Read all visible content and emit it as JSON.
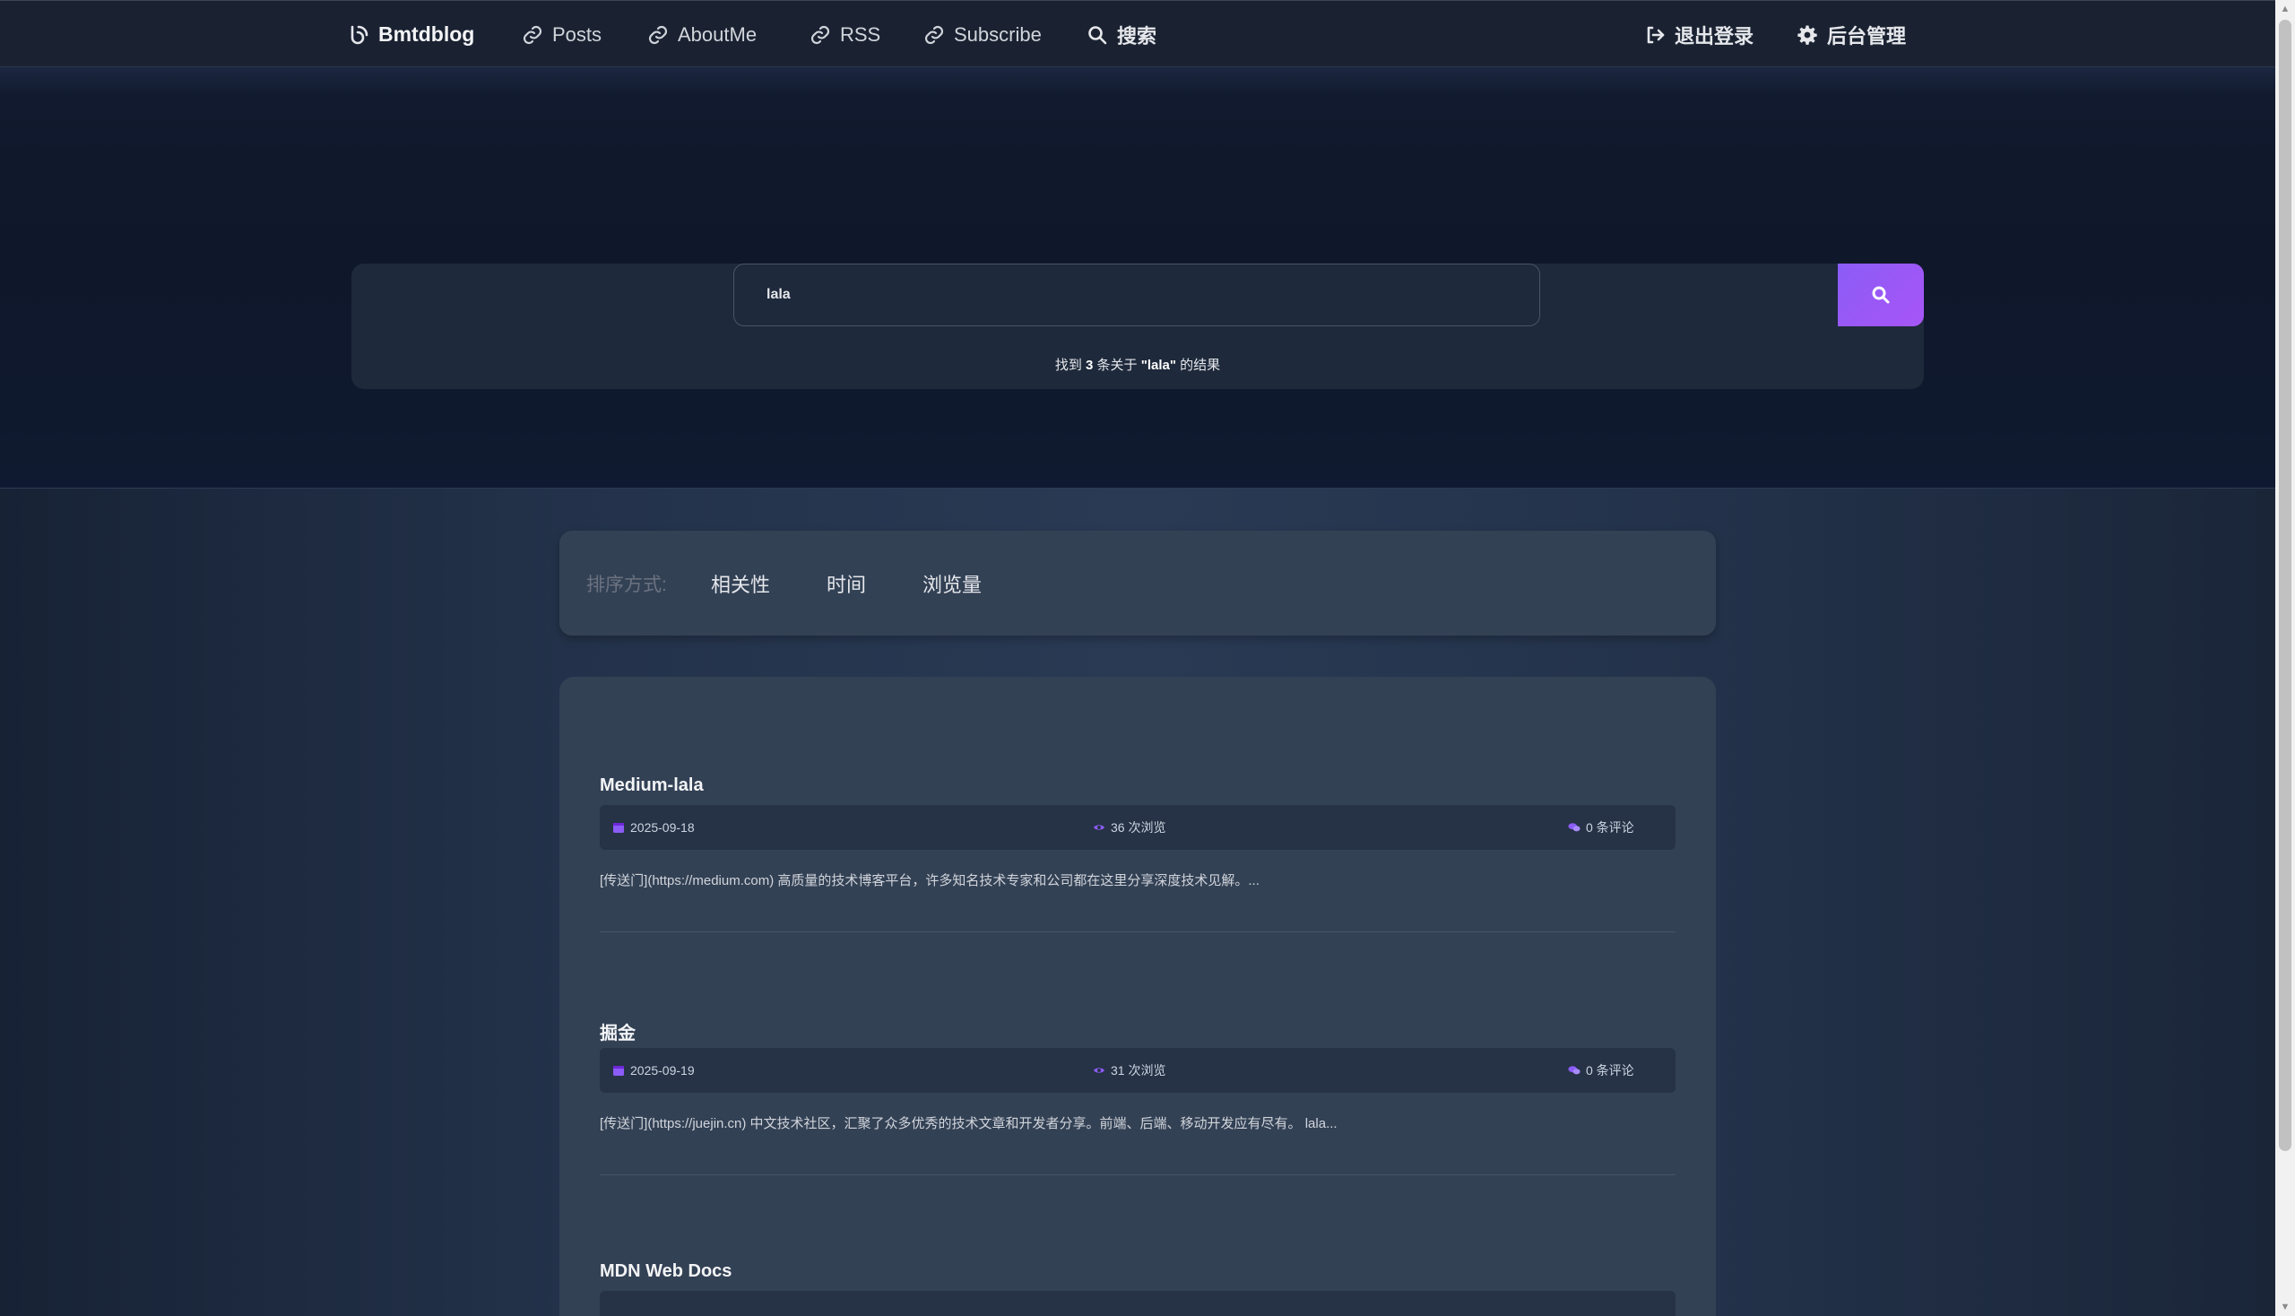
{
  "nav": {
    "brand": "Bmtdblog",
    "links": [
      {
        "label": "Posts",
        "icon": "link-icon"
      },
      {
        "label": "AboutMe",
        "icon": "link-icon"
      },
      {
        "label": "RSS",
        "icon": "link-icon"
      },
      {
        "label": "Subscribe",
        "icon": "link-icon"
      }
    ],
    "search": "搜索",
    "logout": "退出登录",
    "admin": "后台管理"
  },
  "search": {
    "query": "lala",
    "result_prefix": "找到",
    "result_count": "3",
    "result_middle": "条关于",
    "result_term": "\"lala\"",
    "result_suffix": "的结果"
  },
  "sort": {
    "label": "排序方式:",
    "options": [
      "相关性",
      "时间",
      "浏览量"
    ]
  },
  "posts": [
    {
      "title": "Medium-lala",
      "date": "2025-09-18",
      "views": "36 次浏览",
      "comments": "0 条评论",
      "excerpt": "[传送门](https://medium.com) 高质量的技术博客平台，许多知名技术专家和公司都在这里分享深度技术见解。..."
    },
    {
      "title": "掘金",
      "date": "2025-09-19",
      "views": "31 次浏览",
      "comments": "0 条评论",
      "excerpt": "[传送门](https://juejin.cn) 中文技术社区，汇聚了众多优秀的技术文章和开发者分享。前端、后端、移动开发应有尽有。 lala..."
    },
    {
      "title": "MDN Web Docs"
    }
  ],
  "colors": {
    "accent": "#8b5cf6",
    "icon_purple": "#8b5cf6",
    "background": "#1e293b",
    "card": "#334155"
  }
}
